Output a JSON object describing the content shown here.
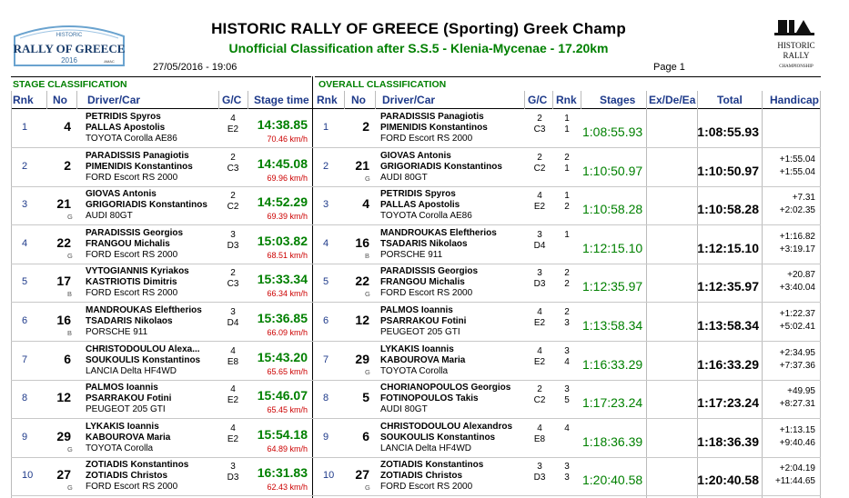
{
  "header": {
    "title": "HISTORIC RALLY OF GREECE (Sporting) Greek Champ",
    "subtitle": "Unofficial Classification after S.S.5 - Klenia-Mycenae - 17.20km",
    "datetime": "27/05/2016 - 19:06",
    "page": "Page 1",
    "logo_text": {
      "top": "HISTORIC",
      "main1": "RALLY OF GREECE",
      "year": "2016",
      "tag": "AMAC"
    },
    "fia_text": {
      "line1": "HISTORIC",
      "line2": "RALLY",
      "line3": "CHAMPIONSHIP"
    }
  },
  "stage": {
    "section_title": "STAGE CLASSIFICATION",
    "headers": {
      "rnk": "Rnk",
      "no": "No",
      "driver": "Driver/Car",
      "gc": "G/C",
      "time": "Stage time"
    },
    "rows": [
      {
        "rnk": "1",
        "no": "4",
        "cls": "",
        "d1": "PETRIDIS Spyros",
        "d2": "PALLAS Apostolis",
        "car": "TOYOTA Corolla AE86",
        "g": "4",
        "c": "E2",
        "time": "14:38.85",
        "speed": "70.46 km/h"
      },
      {
        "rnk": "2",
        "no": "2",
        "cls": "",
        "d1": "PARADISSIS Panagiotis",
        "d2": "PIMENIDIS Konstantinos",
        "car": "FORD Escort RS 2000",
        "g": "2",
        "c": "C3",
        "time": "14:45.08",
        "speed": "69.96 km/h"
      },
      {
        "rnk": "3",
        "no": "21",
        "cls": "G",
        "d1": "GIOVAS Antonis",
        "d2": "GRIGORIADIS Konstantinos",
        "car": "AUDI 80GT",
        "g": "2",
        "c": "C2",
        "time": "14:52.29",
        "speed": "69.39 km/h"
      },
      {
        "rnk": "4",
        "no": "22",
        "cls": "G",
        "d1": "PARADISSIS Georgios",
        "d2": "FRANGOU Michalis",
        "car": "FORD Escort RS 2000",
        "g": "3",
        "c": "D3",
        "time": "15:03.82",
        "speed": "68.51 km/h"
      },
      {
        "rnk": "5",
        "no": "17",
        "cls": "B",
        "d1": "VYTOGIANNIS Kyriakos",
        "d2": "KASTRIOTIS Dimitris",
        "car": "FORD Escort RS 2000",
        "g": "2",
        "c": "C3",
        "time": "15:33.34",
        "speed": "66.34 km/h"
      },
      {
        "rnk": "6",
        "no": "16",
        "cls": "B",
        "d1": "MANDROUKAS Eleftherios",
        "d2": "TSADARIS Nikolaos",
        "car": "PORSCHE 911",
        "g": "3",
        "c": "D4",
        "time": "15:36.85",
        "speed": "66.09 km/h"
      },
      {
        "rnk": "7",
        "no": "6",
        "cls": "",
        "d1": "CHRISTODOULOU Alexa...",
        "d2": "SOUKOULIS Konstantinos",
        "car": "LANCIA Delta HF4WD",
        "g": "4",
        "c": "E8",
        "time": "15:43.20",
        "speed": "65.65 km/h"
      },
      {
        "rnk": "8",
        "no": "12",
        "cls": "",
        "d1": "PALMOS Ioannis",
        "d2": "PSARRAKOU Fotini",
        "car": "PEUGEOT 205 GTI",
        "g": "4",
        "c": "E2",
        "time": "15:46.07",
        "speed": "65.45 km/h"
      },
      {
        "rnk": "9",
        "no": "29",
        "cls": "G",
        "d1": "LYKAKIS Ioannis",
        "d2": "KABOUROVA Maria",
        "car": "TOYOTA Corolla",
        "g": "4",
        "c": "E2",
        "time": "15:54.18",
        "speed": "64.89 km/h"
      },
      {
        "rnk": "10",
        "no": "27",
        "cls": "G",
        "d1": "ZOTIADIS Konstantinos",
        "d2": "ZOTIADIS Christos",
        "car": "FORD Escort RS 2000",
        "g": "3",
        "c": "D3",
        "time": "16:31.83",
        "speed": "62.43 km/h"
      }
    ]
  },
  "overall": {
    "section_title": "OVERALL CLASSIFICATION",
    "headers": {
      "rnk": "Rnk",
      "no": "No",
      "driver": "Driver/Car",
      "gc": "G/C",
      "rnk2": "Rnk",
      "stages": "Stages",
      "ex": "Ex/De/Ea",
      "total": "Total",
      "handicap": "Handicap"
    },
    "rows": [
      {
        "rnk": "1",
        "no": "2",
        "cls": "",
        "d1": "PARADISSIS Panagiotis",
        "d2": "PIMENIDIS Konstantinos",
        "car": "FORD Escort RS 2000",
        "g": "2",
        "c": "C3",
        "r1": "1",
        "r2": "1",
        "stages": "1:08:55.93",
        "total": "1:08:55.93",
        "h1": "",
        "h2": ""
      },
      {
        "rnk": "2",
        "no": "21",
        "cls": "G",
        "d1": "GIOVAS Antonis",
        "d2": "GRIGORIADIS Konstantinos",
        "car": "AUDI 80GT",
        "g": "2",
        "c": "C2",
        "r1": "2",
        "r2": "1",
        "stages": "1:10:50.97",
        "total": "1:10:50.97",
        "h1": "+1:55.04",
        "h2": "+1:55.04"
      },
      {
        "rnk": "3",
        "no": "4",
        "cls": "",
        "d1": "PETRIDIS Spyros",
        "d2": "PALLAS Apostolis",
        "car": "TOYOTA Corolla AE86",
        "g": "4",
        "c": "E2",
        "r1": "1",
        "r2": "2",
        "stages": "1:10:58.28",
        "total": "1:10:58.28",
        "h1": "+7.31",
        "h2": "+2:02.35"
      },
      {
        "rnk": "4",
        "no": "16",
        "cls": "B",
        "d1": "MANDROUKAS Eleftherios",
        "d2": "TSADARIS Nikolaos",
        "car": "PORSCHE 911",
        "g": "3",
        "c": "D4",
        "r1": "1",
        "r2": "",
        "stages": "1:12:15.10",
        "total": "1:12:15.10",
        "h1": "+1:16.82",
        "h2": "+3:19.17"
      },
      {
        "rnk": "5",
        "no": "22",
        "cls": "G",
        "d1": "PARADISSIS Georgios",
        "d2": "FRANGOU Michalis",
        "car": "FORD Escort RS 2000",
        "g": "3",
        "c": "D3",
        "r1": "2",
        "r2": "2",
        "stages": "1:12:35.97",
        "total": "1:12:35.97",
        "h1": "+20.87",
        "h2": "+3:40.04"
      },
      {
        "rnk": "6",
        "no": "12",
        "cls": "",
        "d1": "PALMOS Ioannis",
        "d2": "PSARRAKOU Fotini",
        "car": "PEUGEOT 205 GTI",
        "g": "4",
        "c": "E2",
        "r1": "2",
        "r2": "3",
        "stages": "1:13:58.34",
        "total": "1:13:58.34",
        "h1": "+1:22.37",
        "h2": "+5:02.41"
      },
      {
        "rnk": "7",
        "no": "29",
        "cls": "G",
        "d1": "LYKAKIS Ioannis",
        "d2": "KABOUROVA Maria",
        "car": "TOYOTA Corolla",
        "g": "4",
        "c": "E2",
        "r1": "3",
        "r2": "4",
        "stages": "1:16:33.29",
        "total": "1:16:33.29",
        "h1": "+2:34.95",
        "h2": "+7:37.36"
      },
      {
        "rnk": "8",
        "no": "5",
        "cls": "",
        "d1": "CHORIANOPOULOS Georgios",
        "d2": "FOTINOPOULOS Takis",
        "car": "AUDI 80GT",
        "g": "2",
        "c": "C2",
        "r1": "3",
        "r2": "5",
        "stages": "1:17:23.24",
        "total": "1:17:23.24",
        "h1": "+49.95",
        "h2": "+8:27.31"
      },
      {
        "rnk": "9",
        "no": "6",
        "cls": "",
        "d1": "CHRISTODOULOU Alexandros",
        "d2": "SOUKOULIS Konstantinos",
        "car": "LANCIA Delta HF4WD",
        "g": "4",
        "c": "E8",
        "r1": "4",
        "r2": "",
        "stages": "1:18:36.39",
        "total": "1:18:36.39",
        "h1": "+1:13.15",
        "h2": "+9:40.46"
      },
      {
        "rnk": "10",
        "no": "27",
        "cls": "G",
        "d1": "ZOTIADIS Konstantinos",
        "d2": "ZOTIADIS Christos",
        "car": "FORD Escort RS 2000",
        "g": "3",
        "c": "D3",
        "r1": "3",
        "r2": "3",
        "stages": "1:20:40.58",
        "total": "1:20:40.58",
        "h1": "+2:04.19",
        "h2": "+11:44.65"
      }
    ]
  }
}
